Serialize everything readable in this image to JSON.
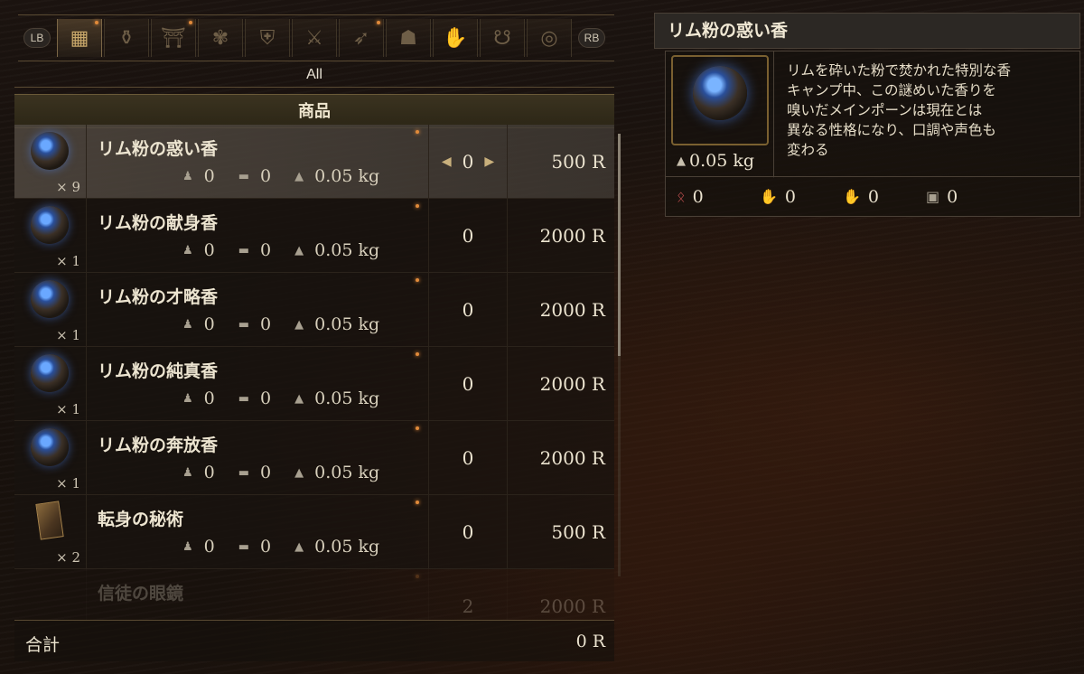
{
  "tabs": {
    "left_bumper": "LB",
    "right_bumper": "RB",
    "items": [
      {
        "icon": "grid-icon",
        "glyph": "▦",
        "active": true,
        "new": true
      },
      {
        "icon": "potion-icon",
        "glyph": "⚱",
        "active": false,
        "new": false
      },
      {
        "icon": "gate-icon",
        "glyph": "⛩",
        "active": false,
        "new": true
      },
      {
        "icon": "creature-icon",
        "glyph": "✾",
        "active": false,
        "new": false
      },
      {
        "icon": "chest-armor-icon",
        "glyph": "⛨",
        "active": false,
        "new": false
      },
      {
        "icon": "sword-icon",
        "glyph": "⚔",
        "active": false,
        "new": false
      },
      {
        "icon": "bow-icon",
        "glyph": "➶",
        "active": false,
        "new": true
      },
      {
        "icon": "helmet-icon",
        "glyph": "☗",
        "active": false,
        "new": false
      },
      {
        "icon": "arm-icon",
        "glyph": "✋",
        "active": false,
        "new": false
      },
      {
        "icon": "leg-icon",
        "glyph": "☋",
        "active": false,
        "new": false
      },
      {
        "icon": "ring-icon",
        "glyph": "◎",
        "active": false,
        "new": false
      }
    ]
  },
  "filter_label": "All",
  "list_header": "商品",
  "items": [
    {
      "name": "リム粉の惑い香",
      "icon": "incense-pouch-icon",
      "qty": "× 9",
      "stat1": "0",
      "stat2": "0",
      "weight": "0.05 kg",
      "count": "0",
      "price": "500 R",
      "selected": true
    },
    {
      "name": "リム粉の献身香",
      "icon": "incense-pouch-icon",
      "qty": "× 1",
      "stat1": "0",
      "stat2": "0",
      "weight": "0.05 kg",
      "count": "0",
      "price": "2000 R"
    },
    {
      "name": "リム粉の才略香",
      "icon": "incense-pouch-icon",
      "qty": "× 1",
      "stat1": "0",
      "stat2": "0",
      "weight": "0.05 kg",
      "count": "0",
      "price": "2000 R"
    },
    {
      "name": "リム粉の純真香",
      "icon": "incense-pouch-icon",
      "qty": "× 1",
      "stat1": "0",
      "stat2": "0",
      "weight": "0.05 kg",
      "count": "0",
      "price": "2000 R"
    },
    {
      "name": "リム粉の奔放香",
      "icon": "incense-pouch-icon",
      "qty": "× 1",
      "stat1": "0",
      "stat2": "0",
      "weight": "0.05 kg",
      "count": "0",
      "price": "2000 R"
    },
    {
      "name": "転身の秘術",
      "icon": "book-icon",
      "qty": "× 2",
      "stat1": "0",
      "stat2": "0",
      "weight": "0.05 kg",
      "count": "0",
      "price": "500 R"
    },
    {
      "name": "信徒の眼鏡",
      "icon": "",
      "qty": "",
      "stat1": "",
      "stat2": "",
      "weight": "",
      "count": "2",
      "price": "2000 R",
      "faded": true
    }
  ],
  "total": {
    "label": "合計",
    "value": "0 R"
  },
  "detail": {
    "title": "リム粉の惑い香",
    "description": "リムを砕いた粉で焚かれた特別な香\nキャンプ中、この謎めいた香りを\n嗅いだメインポーンは現在とは\n異なる性格になり、口調や声色も\n変わる",
    "weight": "0.05 kg",
    "stats": [
      {
        "icon": "red-rune-icon",
        "glyph": "ᛟ",
        "color": "#c05050",
        "value": "0"
      },
      {
        "icon": "blue-hand-icon",
        "glyph": "✋",
        "color": "#4f7fe0",
        "value": "0"
      },
      {
        "icon": "bone-hand-icon",
        "glyph": "✋",
        "color": "#b0a890",
        "value": "0"
      },
      {
        "icon": "chest-icon",
        "glyph": "▣",
        "color": "#a8a090",
        "value": "0"
      }
    ]
  }
}
